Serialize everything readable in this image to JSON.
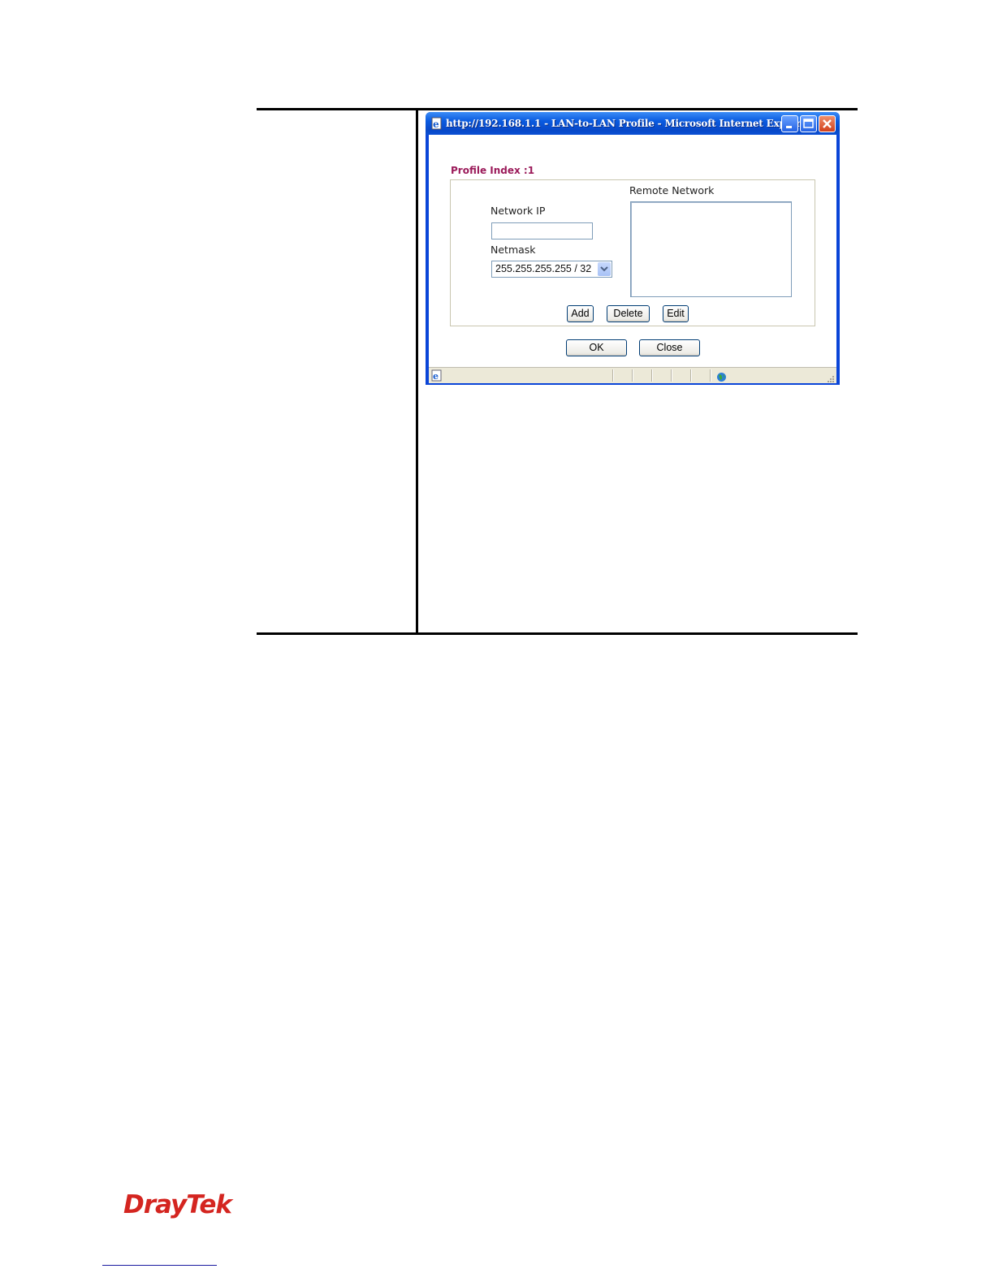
{
  "window": {
    "title": "http://192.168.1.1 - LAN-to-LAN Profile - Microsoft Internet Explorer"
  },
  "dialog": {
    "profile_index": "Profile Index :1",
    "network_ip_label": "Network IP",
    "network_ip_value": "",
    "netmask_label": "Netmask",
    "netmask_selected": "255.255.255.255 / 32",
    "remote_network_label": "Remote Network",
    "remote_network_items": [],
    "add_label": "Add",
    "delete_label": "Delete",
    "edit_label": "Edit",
    "ok_label": "OK",
    "close_label": "Close"
  },
  "footer": {
    "brand_dray": "Dray",
    "brand_tek": "Tek"
  },
  "icons": [
    "ie-page-icon",
    "minimize-icon",
    "maximize-icon",
    "close-icon",
    "chevron-down-icon",
    "ie-status-icon",
    "internet-zone-icon",
    "resize-grip-icon"
  ],
  "colors": {
    "titlebar": "#0a5be0",
    "profile_index": "#9b1b5a",
    "brand": "#d42520"
  }
}
